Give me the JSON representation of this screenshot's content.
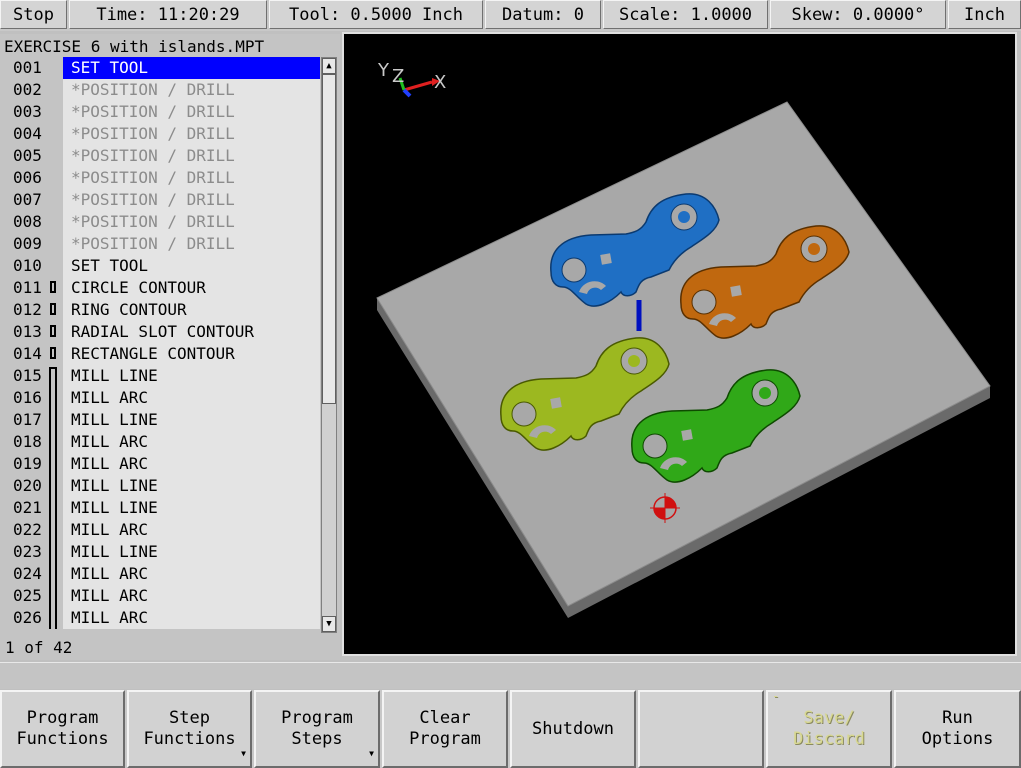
{
  "status_bar": {
    "stop_label": "Stop",
    "time": "Time: 11:20:29",
    "tool": "Tool: 0.5000 Inch",
    "datum": "Datum: 0",
    "scale": "Scale: 1.0000",
    "skew": "Skew: 0.0000°",
    "units": "Inch"
  },
  "program": {
    "title": "EXERCISE 6 with islands.MPT",
    "counter": "1 of 42",
    "lines": [
      {
        "num": "001",
        "text": "SET TOOL",
        "state": "selected"
      },
      {
        "num": "002",
        "text": "*POSITION / DRILL",
        "state": "dim"
      },
      {
        "num": "003",
        "text": "*POSITION / DRILL",
        "state": "dim"
      },
      {
        "num": "004",
        "text": "*POSITION / DRILL",
        "state": "dim"
      },
      {
        "num": "005",
        "text": "*POSITION / DRILL",
        "state": "dim"
      },
      {
        "num": "006",
        "text": "*POSITION / DRILL",
        "state": "dim"
      },
      {
        "num": "007",
        "text": "*POSITION / DRILL",
        "state": "dim"
      },
      {
        "num": "008",
        "text": "*POSITION / DRILL",
        "state": "dim"
      },
      {
        "num": "009",
        "text": "*POSITION / DRILL",
        "state": "dim"
      },
      {
        "num": "010",
        "text": "SET TOOL",
        "state": "normal"
      },
      {
        "num": "011",
        "text": "CIRCLE CONTOUR",
        "state": "normal",
        "marker": "box"
      },
      {
        "num": "012",
        "text": "RING CONTOUR",
        "state": "normal",
        "marker": "box"
      },
      {
        "num": "013",
        "text": "RADIAL SLOT CONTOUR",
        "state": "normal",
        "marker": "box"
      },
      {
        "num": "014",
        "text": "RECTANGLE CONTOUR",
        "state": "normal",
        "marker": "box"
      },
      {
        "num": "015",
        "text": "MILL LINE",
        "state": "normal",
        "marker": "bracket-start"
      },
      {
        "num": "016",
        "text": "MILL ARC",
        "state": "normal",
        "marker": "bracket"
      },
      {
        "num": "017",
        "text": "MILL LINE",
        "state": "normal",
        "marker": "bracket"
      },
      {
        "num": "018",
        "text": "MILL ARC",
        "state": "normal",
        "marker": "bracket"
      },
      {
        "num": "019",
        "text": "MILL ARC",
        "state": "normal",
        "marker": "bracket"
      },
      {
        "num": "020",
        "text": "MILL LINE",
        "state": "normal",
        "marker": "bracket"
      },
      {
        "num": "021",
        "text": "MILL LINE",
        "state": "normal",
        "marker": "bracket"
      },
      {
        "num": "022",
        "text": "MILL ARC",
        "state": "normal",
        "marker": "bracket"
      },
      {
        "num": "023",
        "text": "MILL LINE",
        "state": "normal",
        "marker": "bracket"
      },
      {
        "num": "024",
        "text": "MILL ARC",
        "state": "normal",
        "marker": "bracket"
      },
      {
        "num": "025",
        "text": "MILL ARC",
        "state": "normal",
        "marker": "bracket"
      },
      {
        "num": "026",
        "text": "MILL ARC",
        "state": "normal",
        "marker": "bracket"
      }
    ]
  },
  "viewport": {
    "axis_labels": {
      "y": "Y",
      "z": "Z",
      "x": "X"
    },
    "background": "#000000",
    "plate_color": "#a8a8a8",
    "part_colors": [
      "#1f6fc4",
      "#c0680f",
      "#9cb820",
      "#30a818"
    ],
    "tool_color": "#0010c0",
    "origin_marker": "datum-target-icon"
  },
  "softkeys": [
    {
      "label": "Program\nFunctions",
      "enabled": true
    },
    {
      "label": "Step\nFunctions",
      "enabled": true,
      "submenu": true
    },
    {
      "label": "Program\nSteps",
      "enabled": true,
      "submenu": true
    },
    {
      "label": "Clear\nProgram",
      "enabled": true
    },
    {
      "label": "Shutdown",
      "enabled": true
    },
    {
      "label": "",
      "enabled": true
    },
    {
      "label": "Save/\nDiscard",
      "enabled": false
    },
    {
      "label": "Run\nOptions",
      "enabled": true
    }
  ]
}
